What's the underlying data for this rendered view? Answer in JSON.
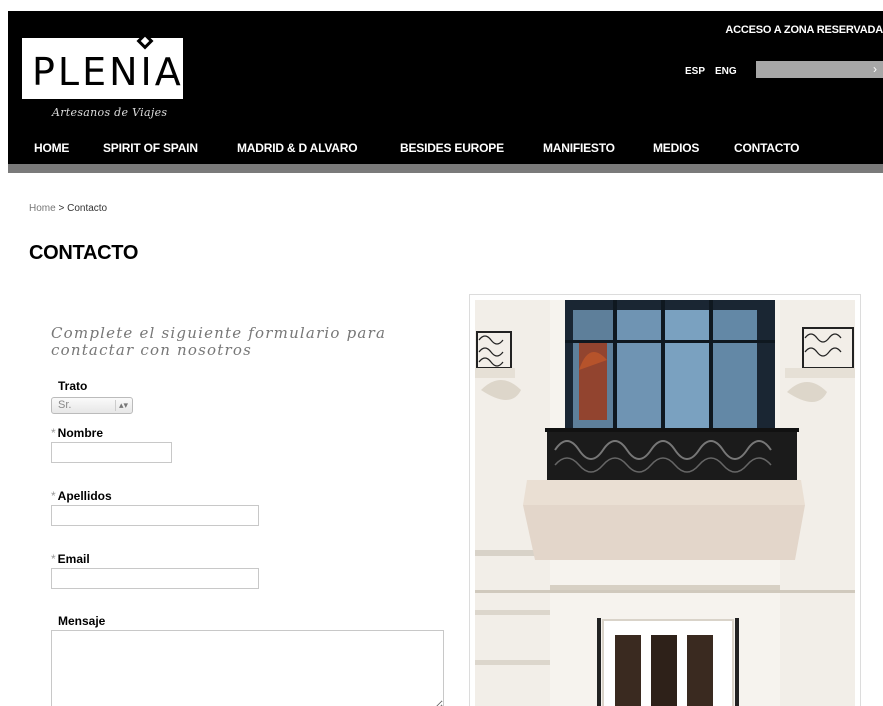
{
  "header": {
    "logo_text": "PLENIA",
    "logo_tagline": "Artesanos de Viajes",
    "reserved_link": "ACCESO A ZONA RESERVADA",
    "lang_esp": "ESP",
    "lang_eng": "ENG",
    "search_arrow": "›"
  },
  "nav": {
    "items": [
      {
        "label": "HOME"
      },
      {
        "label": "SPIRIT OF SPAIN"
      },
      {
        "label": "MADRID & D ALVARO"
      },
      {
        "label": "BESIDES EUROPE"
      },
      {
        "label": "MANIFIESTO"
      },
      {
        "label": "MEDIOS"
      },
      {
        "label": "CONTACTO"
      }
    ]
  },
  "breadcrumb": {
    "home": "Home",
    "separator": " > ",
    "current": "Contacto"
  },
  "page": {
    "title": "CONTACTO"
  },
  "form": {
    "intro": "Complete el siguiente formulario para contactar con nosotros",
    "required_marker": "*",
    "trato": {
      "label": "Trato",
      "value": "Sr.",
      "arrows": "▴▾"
    },
    "nombre": {
      "label": "Nombre",
      "value": ""
    },
    "apellidos": {
      "label": "Apellidos",
      "value": ""
    },
    "email": {
      "label": "Email",
      "value": ""
    },
    "mensaje": {
      "label": "Mensaje",
      "value": ""
    }
  },
  "colors": {
    "header_bg": "#000000",
    "nav_underline": "#7a7a7a",
    "search_bg": "#a7a7a7",
    "intro_text": "#777777"
  }
}
